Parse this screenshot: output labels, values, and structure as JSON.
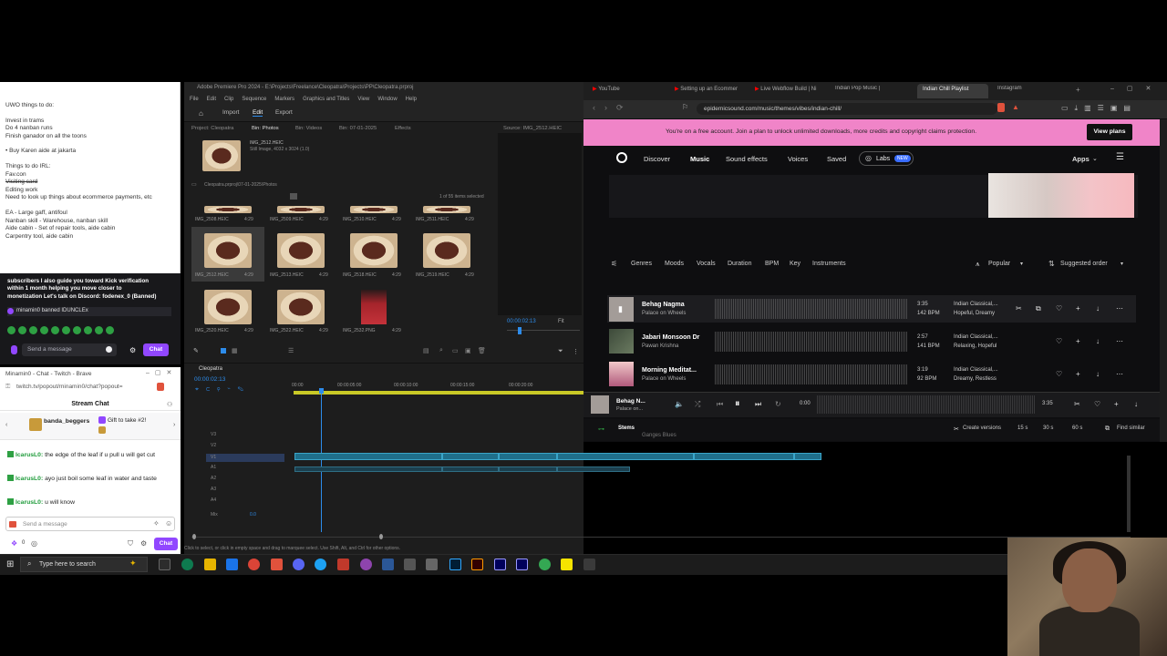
{
  "notes": {
    "lines": [
      {
        "t": "UWO things to do:",
        "s": false
      },
      {
        "t": "",
        "s": false
      },
      {
        "t": "Invest in trams",
        "s": false
      },
      {
        "t": "Do 4 nanban runs",
        "s": false
      },
      {
        "t": "Finish ganador on all the toons",
        "s": false
      },
      {
        "t": "",
        "s": false
      },
      {
        "t": "• Buy Karen aide at jakarta",
        "s": false
      },
      {
        "t": "",
        "s": false
      },
      {
        "t": "Things to do IRL:",
        "s": false
      },
      {
        "t": "Fav.con",
        "s": false
      },
      {
        "t": "Visiting card",
        "s": true
      },
      {
        "t": "Editing work",
        "s": false
      },
      {
        "t": "Need to look up things about ecommerce payments, etc",
        "s": false
      },
      {
        "t": "",
        "s": false
      },
      {
        "t": "EA - Large gaff, antifoul",
        "s": false
      },
      {
        "t": "Nanban skill - Warehouse, nanban skill",
        "s": false
      },
      {
        "t": "Aide cabin - Set of repair tools, aide cabin",
        "s": false
      },
      {
        "t": "Carpentry tool, aide cabin",
        "s": false
      }
    ]
  },
  "twitch_top": {
    "messages": [
      "subscribers I also guide you toward Kick verification",
      "within 1 month helping you move closer to",
      "monetization Let's talk on Discord: fodenex_0 (Banned)"
    ],
    "banned_line": "minamin0 banned IDUNCLEx",
    "send_placeholder": "Send a message",
    "chat_button": "Chat"
  },
  "chat": {
    "window_title": "Minamin0 - Chat - Twitch - Brave",
    "url": "twitch.tv/popout/minamin0/chat?popout=",
    "header": "Stream Chat",
    "gift_user": "banda_beggers",
    "gift_text": "Gift to take #2!",
    "messages": [
      {
        "user": "IcarusL0:",
        "text": "the edge of the leaf if u pull u will get cut"
      },
      {
        "user": "IcarusL0:",
        "text": "ayo just boil some leaf in water and taste"
      },
      {
        "user": "IcarusL0:",
        "text": "u will know"
      }
    ],
    "send_placeholder": "Send a message",
    "chat_button": "Chat"
  },
  "premiere": {
    "title": "Adobe Premiere Pro 2024 - E:\\Projects\\Freelance\\Cleopatra\\Projects\\PP\\Cleopatra.prproj",
    "menu": [
      "File",
      "Edit",
      "Clip",
      "Sequence",
      "Markers",
      "Graphics and Titles",
      "View",
      "Window",
      "Help"
    ],
    "tabs": [
      "Import",
      "Edit",
      "Export"
    ],
    "project_label": "Project: Cleopatra",
    "bins": [
      "Bin: Photos",
      "Bin: Videos",
      "Bin: 07-01-2025",
      "Effects"
    ],
    "source_label": "Source: IMG_2512.HEIC",
    "clip_info_name": "IMG_2512.HEIC",
    "clip_info_detail": "Still Image, 4032 x 3024 (1.0)",
    "path": "Cleopatra.prproj\\07-01-2025\\Photos",
    "items_selected": "1 of 55 items selected",
    "thumbs": [
      {
        "name": "IMG_2508.HEIC",
        "dur": "4:29"
      },
      {
        "name": "IMG_2509.HEIC",
        "dur": "4:29"
      },
      {
        "name": "IMG_2510.HEIC",
        "dur": "4:29"
      },
      {
        "name": "IMG_2511.HEIC",
        "dur": "4:29"
      },
      {
        "name": "IMG_2512.HEIC",
        "dur": "4:29"
      },
      {
        "name": "IMG_2513.HEIC",
        "dur": "4:29"
      },
      {
        "name": "IMG_2518.HEIC",
        "dur": "4:29"
      },
      {
        "name": "IMG_2519.HEIC",
        "dur": "4:29"
      },
      {
        "name": "IMG_2520.HEIC",
        "dur": "4:29"
      },
      {
        "name": "IMG_2522.HEIC",
        "dur": "4:29"
      },
      {
        "name": "IMG_2532.PNG",
        "dur": "4:29"
      }
    ],
    "source_timecode": "00:00:02:13",
    "fit": "Fit",
    "sequence_name": "Cleopatra",
    "timeline_timecode": "00:00:02:13",
    "ruler": [
      "00:00",
      "00:00:05:00",
      "00:00:10:00",
      "00:00:15:00",
      "00:00:20:00"
    ],
    "tracks": [
      "V3",
      "V2",
      "V1",
      "A1",
      "A2",
      "A3",
      "A4",
      "Mix"
    ],
    "mix_value": "0.0",
    "status": "Click to select, or click in empty space and drag to marquee select. Use Shift, Alt, and Ctrl for other options."
  },
  "browser": {
    "tabs": [
      "YouTube",
      "Setting up an Ecommer",
      "Live Webflow Build | Ni",
      "Indian Pop Music |",
      "Indian Chill Playlist",
      "Instagram"
    ],
    "url": "epidemicsound.com/music/themes/vibes/indian-chill/",
    "banner": "You're on a free account. Join a plan to unlock unlimited downloads, more credits and copyright claims protection.",
    "view_plans": "View plans",
    "nav": [
      "Discover",
      "Music",
      "Sound effects",
      "Voices",
      "Saved",
      "Labs",
      "NEW",
      "Apps"
    ],
    "filters": [
      "Genres",
      "Moods",
      "Vocals",
      "Duration",
      "BPM",
      "Key",
      "Instruments"
    ],
    "sort_popular": "Popular",
    "sort_order": "Suggested order",
    "tracks": [
      {
        "title": "Behag Nagma",
        "artist": "Palace on Wheels",
        "len": "3:35",
        "bpm": "142 BPM",
        "genre": "Indian Classical,...",
        "mood": "Hopeful, Dreamy"
      },
      {
        "title": "Jabari Monsoon Dr",
        "artist": "Pawan Krishna",
        "len": "2:57",
        "bpm": "141 BPM",
        "genre": "Indian Classical,...",
        "mood": "Relaxing, Hopeful"
      },
      {
        "title": "Morning Meditat...",
        "artist": "Palace on Wheels",
        "len": "3:19",
        "bpm": "92 BPM",
        "genre": "Indian Classical,...",
        "mood": "Dreamy, Restless"
      }
    ],
    "player": {
      "title": "Behag N...",
      "artist": "Palace on...",
      "elapsed": "0:00",
      "total": "3:35"
    },
    "bottom": {
      "stems": "Stems",
      "next": "Ganges Blues",
      "create_versions": "Create versions",
      "d15": "15 s",
      "d30": "30 s",
      "d60": "60 s",
      "find_similar": "Find similar"
    }
  },
  "taskbar": {
    "search": "Type here to search"
  }
}
